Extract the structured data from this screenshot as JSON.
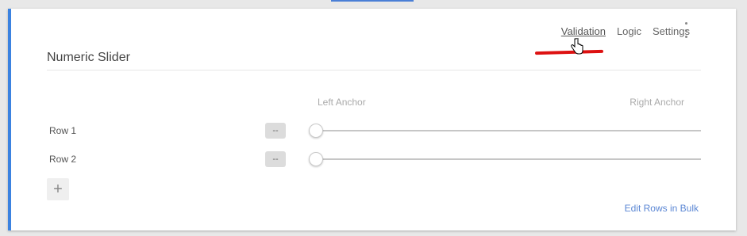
{
  "card": {
    "tabs": [
      {
        "label": "Validation",
        "active": true
      },
      {
        "label": "Logic",
        "active": false
      },
      {
        "label": "Settings",
        "active": false
      }
    ],
    "title": "Numeric Slider",
    "anchors": {
      "left": "Left Anchor",
      "right": "Right Anchor"
    },
    "rows": [
      {
        "label": "Row 1",
        "value": "--"
      },
      {
        "label": "Row 2",
        "value": "--"
      }
    ],
    "add_icon": "plus-icon",
    "bulk_link": "Edit Rows in Bulk"
  },
  "colors": {
    "accent_border": "#3b82e0",
    "annotation_mark": "#dd1111",
    "link": "#5b87d4"
  }
}
